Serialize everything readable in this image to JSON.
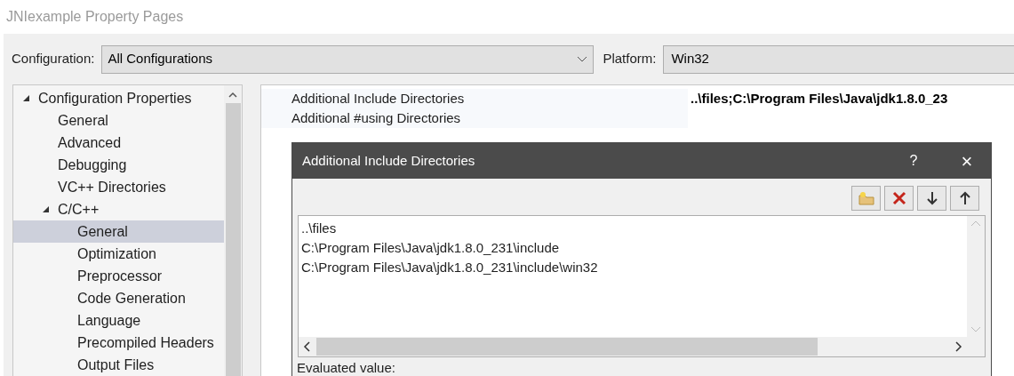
{
  "window": {
    "title": "JNIexample Property Pages"
  },
  "configuration": {
    "label": "Configuration:",
    "value": "All Configurations"
  },
  "platform": {
    "label": "Platform:",
    "value": "Win32"
  },
  "tree": [
    {
      "label": "Configuration Properties",
      "expanded": true,
      "selected": false,
      "children": [
        {
          "label": "General",
          "selected": false
        },
        {
          "label": "Advanced",
          "selected": false
        },
        {
          "label": "Debugging",
          "selected": false
        },
        {
          "label": "VC++ Directories",
          "selected": false
        },
        {
          "label": "C/C++",
          "expanded": true,
          "selected": false,
          "children": [
            {
              "label": "General",
              "selected": true
            },
            {
              "label": "Optimization",
              "selected": false
            },
            {
              "label": "Preprocessor",
              "selected": false
            },
            {
              "label": "Code Generation",
              "selected": false
            },
            {
              "label": "Language",
              "selected": false
            },
            {
              "label": "Precompiled Headers",
              "selected": false
            },
            {
              "label": "Output Files",
              "selected": false
            }
          ]
        }
      ]
    }
  ],
  "properties": [
    {
      "name": "Additional Include Directories",
      "value": "..\\files;C:\\Program Files\\Java\\jdk1.8.0_23"
    },
    {
      "name": "Additional #using Directories"
    }
  ],
  "dialog": {
    "title": "Additional Include Directories",
    "help": "?",
    "close": "×",
    "entries": [
      "..\\files",
      "C:\\Program Files\\Java\\jdk1.8.0_231\\include",
      "C:\\Program Files\\Java\\jdk1.8.0_231\\include\\win32"
    ],
    "evaluated_label": "Evaluated value:"
  }
}
